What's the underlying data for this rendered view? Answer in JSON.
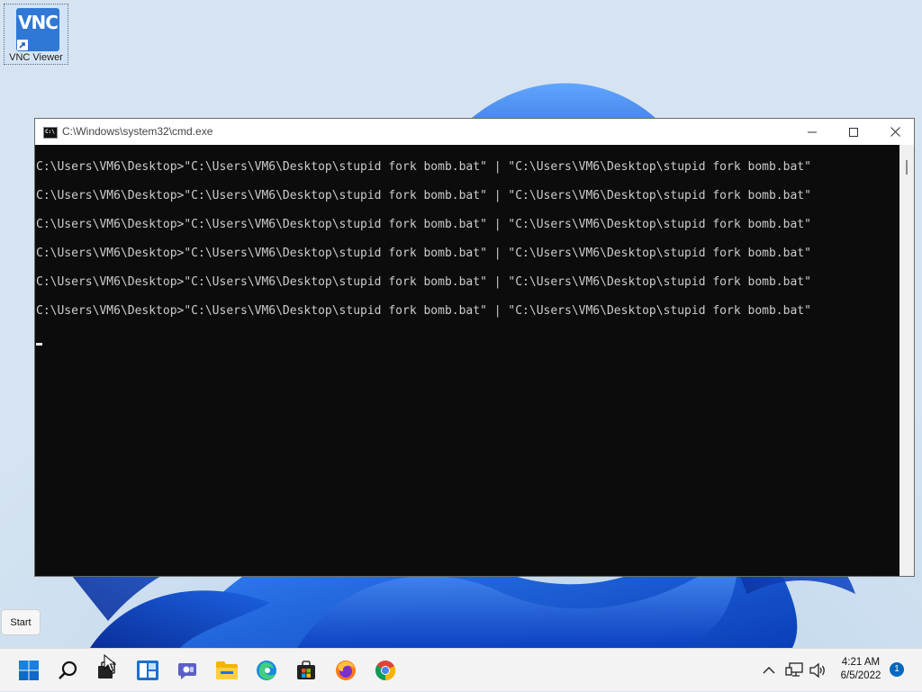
{
  "desktop": {
    "icons": [
      {
        "label": "VNC Viewer",
        "icon": "vnc-viewer-icon",
        "logo_text": "VNC"
      }
    ]
  },
  "window": {
    "title": "C:\\Windows\\system32\\cmd.exe",
    "controls": [
      "minimize",
      "maximize",
      "close"
    ],
    "console_lines": [
      "C:\\Users\\VM6\\Desktop>\"C:\\Users\\VM6\\Desktop\\stupid fork bomb.bat\" | \"C:\\Users\\VM6\\Desktop\\stupid fork bomb.bat\"",
      "C:\\Users\\VM6\\Desktop>\"C:\\Users\\VM6\\Desktop\\stupid fork bomb.bat\" | \"C:\\Users\\VM6\\Desktop\\stupid fork bomb.bat\"",
      "C:\\Users\\VM6\\Desktop>\"C:\\Users\\VM6\\Desktop\\stupid fork bomb.bat\" | \"C:\\Users\\VM6\\Desktop\\stupid fork bomb.bat\"",
      "C:\\Users\\VM6\\Desktop>\"C:\\Users\\VM6\\Desktop\\stupid fork bomb.bat\" | \"C:\\Users\\VM6\\Desktop\\stupid fork bomb.bat\"",
      "C:\\Users\\VM6\\Desktop>\"C:\\Users\\VM6\\Desktop\\stupid fork bomb.bat\" | \"C:\\Users\\VM6\\Desktop\\stupid fork bomb.bat\"",
      "C:\\Users\\VM6\\Desktop>\"C:\\Users\\VM6\\Desktop\\stupid fork bomb.bat\" | \"C:\\Users\\VM6\\Desktop\\stupid fork bomb.bat\""
    ]
  },
  "tooltip": {
    "text": "Start"
  },
  "taskbar": {
    "apps": [
      "start-icon",
      "search-icon",
      "task-view-icon",
      "widgets-icon",
      "teams-chat-icon",
      "file-explorer-icon",
      "edge-icon",
      "store-icon",
      "firefox-icon",
      "chrome-icon"
    ],
    "tray": [
      "chevron-up-icon",
      "network-icon",
      "volume-icon"
    ],
    "time": "4:21 AM",
    "date": "6/5/2022",
    "notification_count": "1"
  },
  "colors": {
    "accent": "#0067c0",
    "console_bg": "#0c0c0c",
    "console_fg": "#cccccc",
    "taskbar_bg": "#f3f3f3"
  }
}
